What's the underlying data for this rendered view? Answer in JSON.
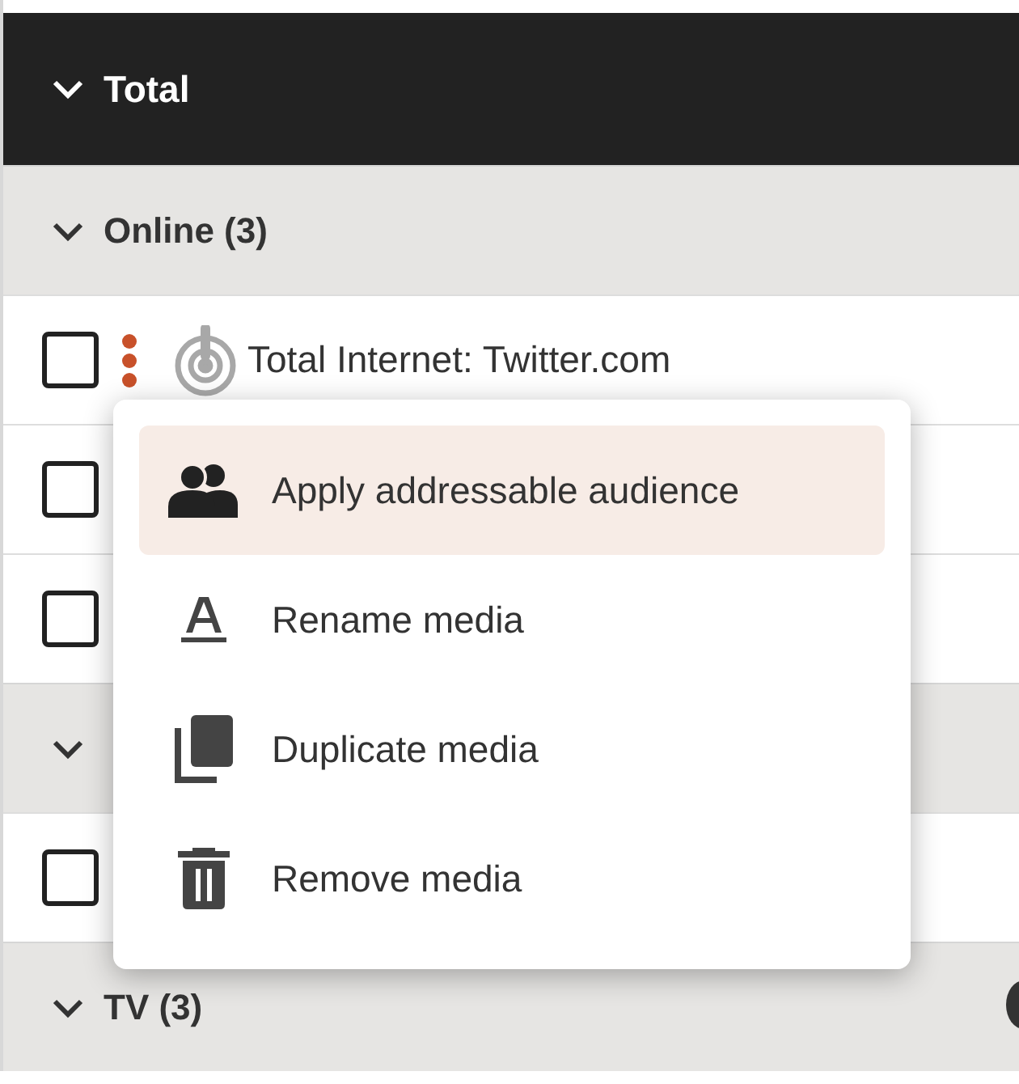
{
  "header": {
    "title": "Total",
    "expanded": true
  },
  "groups": [
    {
      "title": "Online (3)",
      "expanded": true,
      "rows": [
        {
          "checked": false,
          "label": "Total Internet: Twitter.com"
        },
        {
          "checked": false
        },
        {
          "checked": false
        }
      ]
    },
    {
      "expanded": true,
      "rows": [
        {
          "checked": false
        }
      ]
    },
    {
      "title": "TV (3)",
      "expanded": true
    }
  ],
  "menu": {
    "items": [
      {
        "kind": "audience",
        "label": "Apply addressable audience",
        "selected": true
      },
      {
        "kind": "rename",
        "label": "Rename media",
        "selected": false
      },
      {
        "kind": "duplicate",
        "label": "Duplicate media",
        "selected": false
      },
      {
        "kind": "remove",
        "label": "Remove media",
        "selected": false
      }
    ]
  }
}
